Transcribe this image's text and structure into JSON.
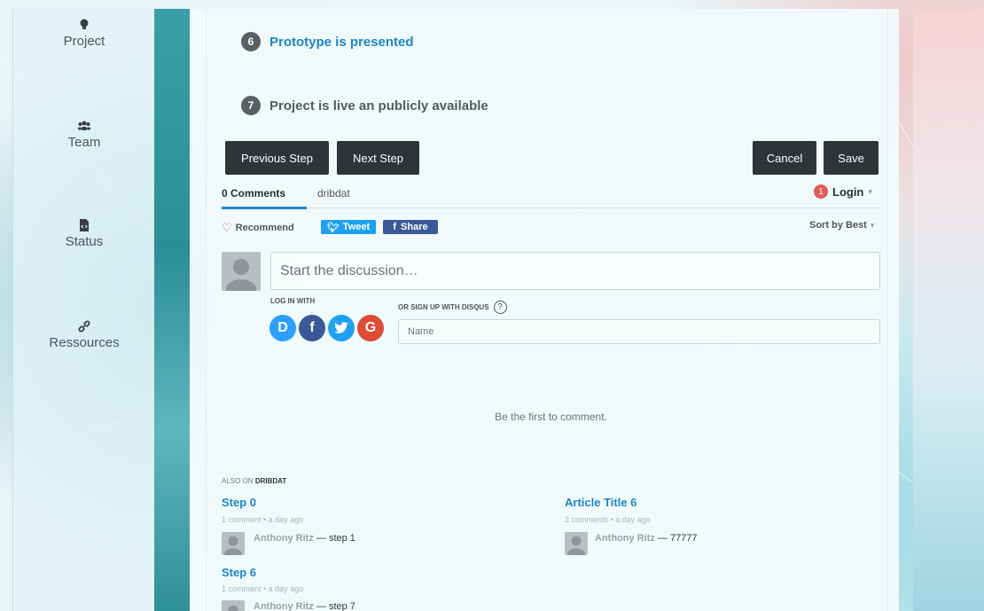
{
  "sidebar": {
    "items": [
      {
        "label": "Project",
        "icon": "lightbulb-icon"
      },
      {
        "label": "Team",
        "icon": "users-icon"
      },
      {
        "label": "Status",
        "icon": "file-code-icon"
      },
      {
        "label": "Ressources",
        "icon": "link-icon"
      }
    ]
  },
  "steps": [
    {
      "number": "6",
      "label": "Prototype is presented",
      "color": "#1d86c7"
    },
    {
      "number": "7",
      "label": "Project is live an publicly available",
      "color": "#555b61"
    }
  ],
  "buttons": {
    "previous": "Previous Step",
    "next": "Next Step",
    "cancel": "Cancel",
    "save": "Save"
  },
  "disqus": {
    "comments_tab": "0 Comments",
    "site_tab": "dribdat",
    "login_badge": "1",
    "login": "Login",
    "recommend": "Recommend",
    "tweet": "Tweet",
    "share": "Share",
    "sort": "Sort by Best",
    "placeholder": "Start the discussion…",
    "log_in_with": "LOG IN WITH",
    "sign_up": "OR SIGN UP WITH DISQUS",
    "help": "?",
    "name_placeholder": "Name",
    "empty": "Be the first to comment.",
    "also_on_prefix": "ALSO ON",
    "also_on_site": "DRIBDAT",
    "social": [
      {
        "letter": "D",
        "color": "#2e9fff",
        "icon": "disqus-icon"
      },
      {
        "letter": "f",
        "color": "#3b5998",
        "icon": "facebook-icon"
      },
      {
        "letter": "t",
        "color": "#1da1f2",
        "icon": "twitter-icon"
      },
      {
        "letter": "G",
        "color": "#dd4b39",
        "icon": "google-icon"
      }
    ],
    "related": [
      {
        "title": "Step 0",
        "meta": "1 comment • a day ago",
        "author": "Anthony Ritz",
        "snippet": "— step 1"
      },
      {
        "title": "Article Title 6",
        "meta": "2 comments • a day ago",
        "author": "Anthony Ritz",
        "snippet": "— 77777"
      },
      {
        "title": "Step 6",
        "meta": "1 comment • a day ago",
        "author": "Anthony Ritz",
        "snippet": "— step 7"
      }
    ]
  },
  "colors": {
    "accent": "#1d86c7",
    "button_dark": "#2f3438",
    "tab_underline": "#1d86c7",
    "recommend_heart": "#e05a5a",
    "twitter": "#1da1f2",
    "facebook": "#3b5998"
  }
}
